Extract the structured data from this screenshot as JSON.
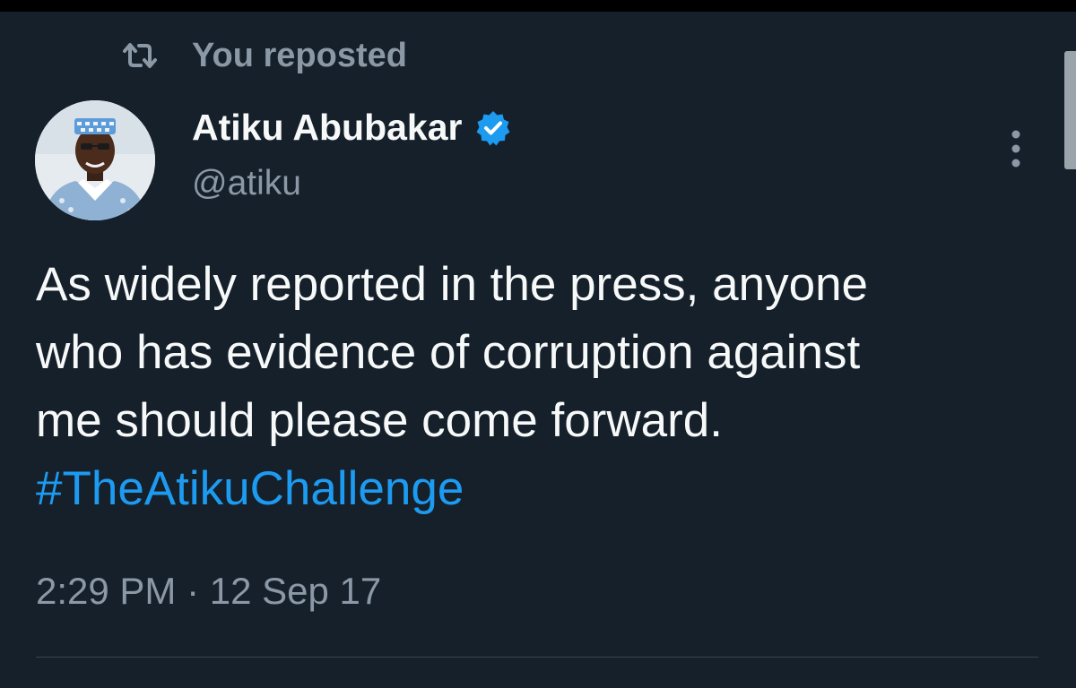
{
  "repost": {
    "icon": "repost-icon",
    "label": "You reposted"
  },
  "author": {
    "name": "Atiku Abubakar",
    "handle": "@atiku",
    "verified_icon": "verified-badge-icon",
    "avatar": "avatar-photo"
  },
  "tweet": {
    "text": "As widely reported in the press, anyone\nwho has evidence of corruption against\nme should please come forward.",
    "hashtag": "#TheAtikuChallenge",
    "timestamp": "2:29 PM · 12 Sep 17"
  },
  "more_menu": {
    "icon": "more-options-icon"
  },
  "colors": {
    "background": "#15202b",
    "text_primary": "#f7f9f9",
    "text_secondary": "#8b98a5",
    "link": "#1d9bf0",
    "verified": "#1d9bf0"
  }
}
